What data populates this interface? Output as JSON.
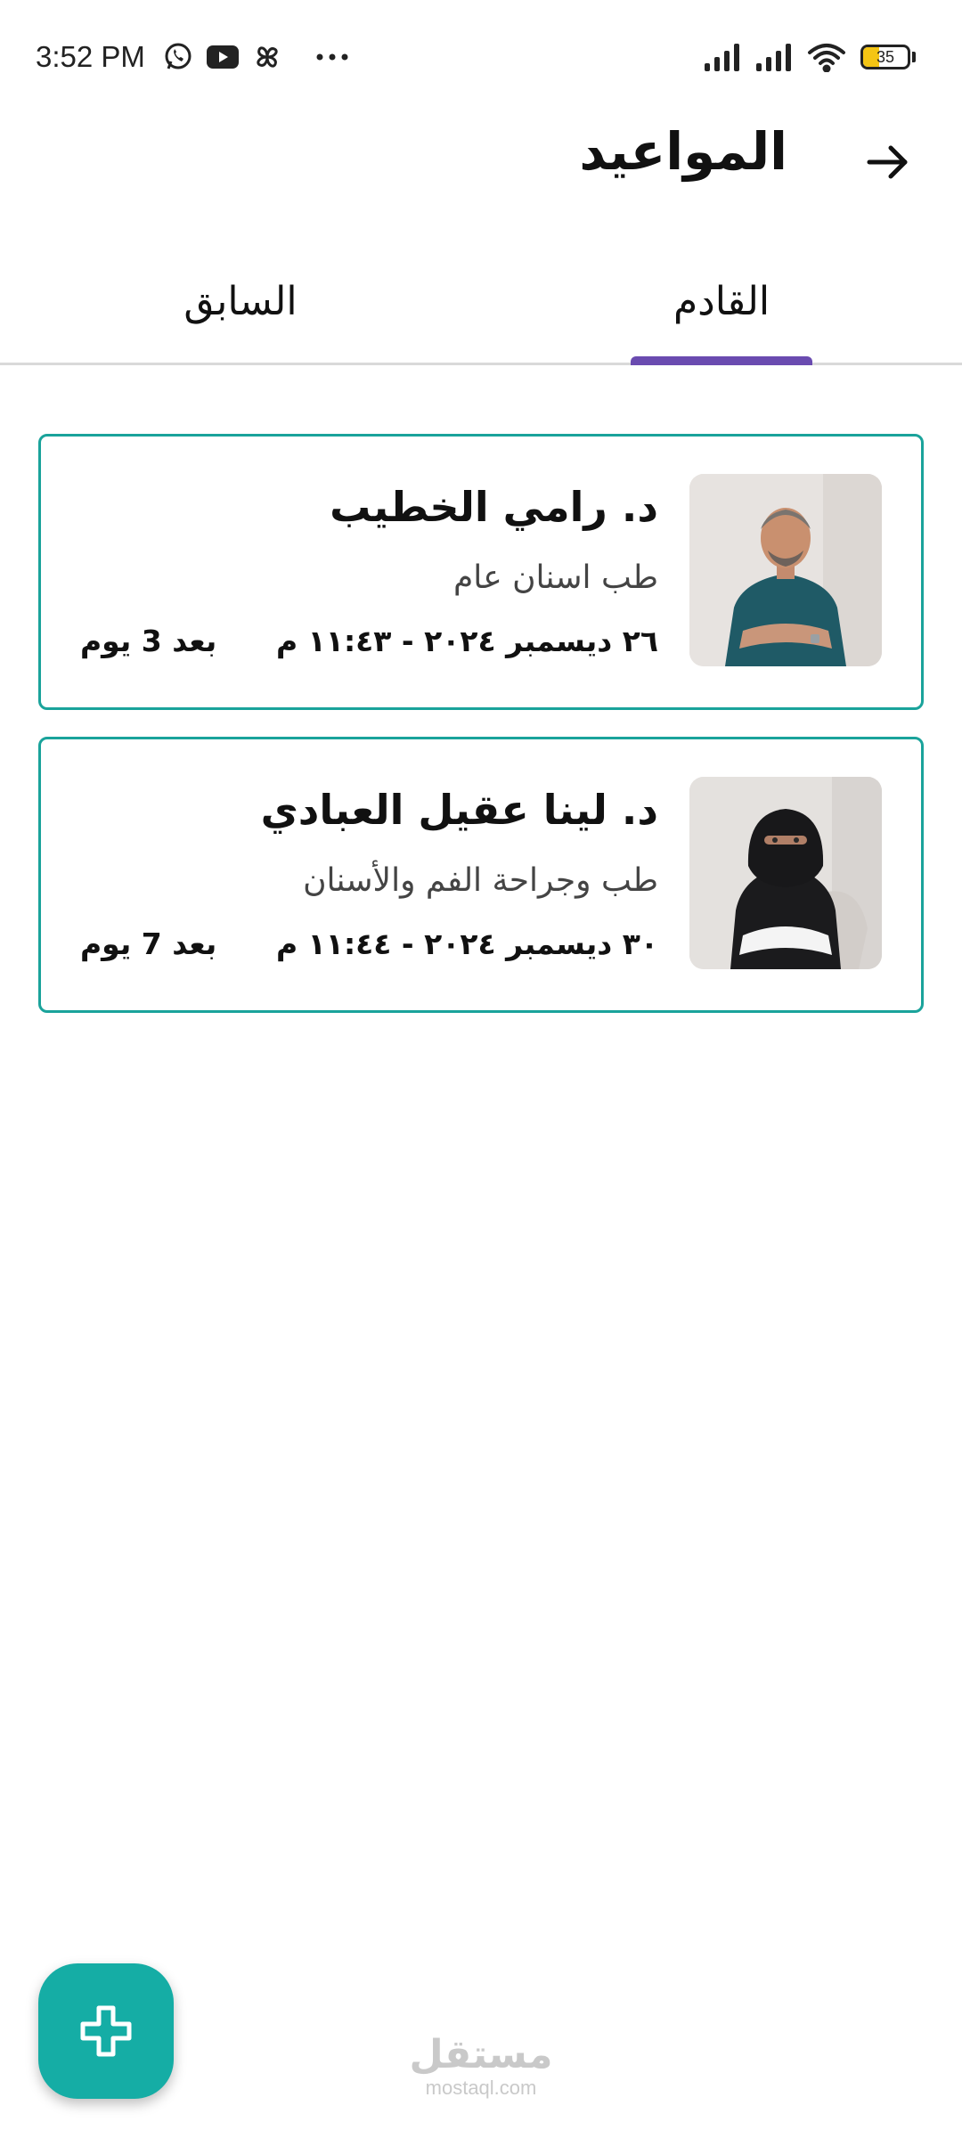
{
  "status_bar": {
    "time": "3:52 PM",
    "battery_level": "35",
    "battery_fraction": 0.35,
    "notification_icons": [
      "whatsapp-icon",
      "youtube-icon",
      "pinwheel-icon",
      "more-dots-icon"
    ],
    "system_icons": [
      "signal-icon",
      "signal-icon",
      "wifi-icon",
      "battery-icon"
    ]
  },
  "header": {
    "title": "المواعيد",
    "back_icon": "arrow-right-icon"
  },
  "tabs": {
    "upcoming_label": "القادم",
    "previous_label": "السابق",
    "active": "upcoming",
    "indicator_color": "#6a4bb0"
  },
  "appointments": [
    {
      "doctor_name": "د. رامي الخطيب",
      "specialty": "طب اسنان عام",
      "datetime": "٢٦ ديسمبر ٢٠٢٤ - ١١:٤٣ م",
      "countdown": "بعد 3 يوم",
      "photo": "male-doctor-photo"
    },
    {
      "doctor_name": "د. لينا عقيل العبادي",
      "specialty": "طب وجراحة الفم والأسنان",
      "datetime": "٣٠ ديسمبر ٢٠٢٤ - ١١:٤٤ م",
      "countdown": "بعد 7 يوم",
      "photo": "female-doctor-photo"
    }
  ],
  "fab": {
    "icon": "plus-icon",
    "color": "#15ada5"
  },
  "watermark": {
    "main": "مستقل",
    "sub": "mostaql.com"
  },
  "colors": {
    "card_border": "#1aa39b",
    "accent": "#15ada5"
  }
}
